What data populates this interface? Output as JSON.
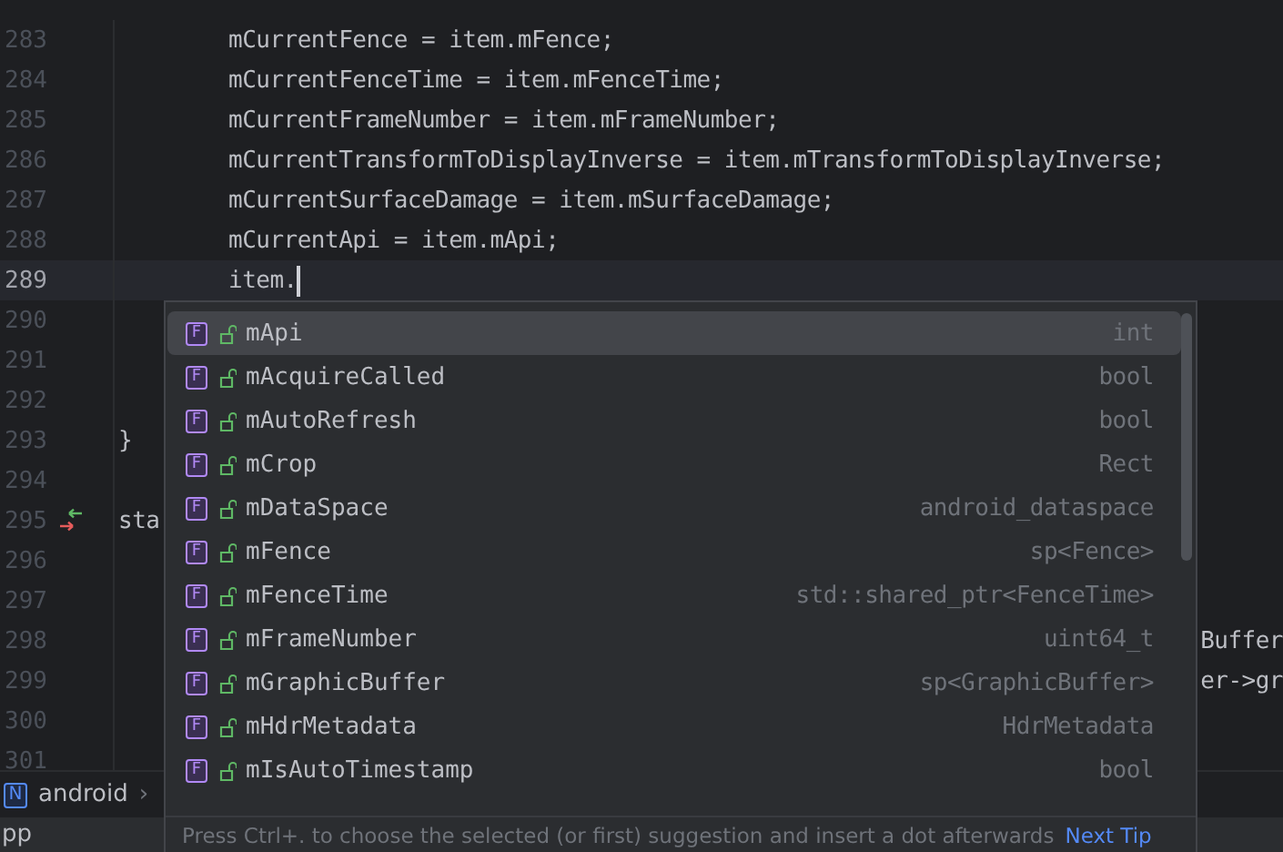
{
  "editor": {
    "lines": [
      {
        "number": "283",
        "text": "        mCurrentFence = item.mFence;",
        "current": false,
        "override": false
      },
      {
        "number": "284",
        "text": "        mCurrentFenceTime = item.mFenceTime;",
        "current": false,
        "override": false
      },
      {
        "number": "285",
        "text": "        mCurrentFrameNumber = item.mFrameNumber;",
        "current": false,
        "override": false
      },
      {
        "number": "286",
        "text": "        mCurrentTransformToDisplayInverse = item.mTransformToDisplayInverse;",
        "current": false,
        "override": false
      },
      {
        "number": "287",
        "text": "        mCurrentSurfaceDamage = item.mSurfaceDamage;",
        "current": false,
        "override": false
      },
      {
        "number": "288",
        "text": "        mCurrentApi = item.mApi;",
        "current": false,
        "override": false
      },
      {
        "number": "289",
        "text": "        item.",
        "current": true,
        "override": false
      },
      {
        "number": "290",
        "current": false,
        "override": false
      },
      {
        "number": "291",
        "current": false,
        "override": false
      },
      {
        "number": "292",
        "current": false,
        "override": false
      },
      {
        "number": "293",
        "text": "}",
        "current": false,
        "override": false
      },
      {
        "number": "294",
        "current": false,
        "override": false
      },
      {
        "number": "295",
        "text": "sta",
        "current": false,
        "override": true
      },
      {
        "number": "296",
        "current": false,
        "override": false
      },
      {
        "number": "297",
        "current": false,
        "override": false
      },
      {
        "number": "298",
        "tail": "Buffer",
        "current": false,
        "override": false
      },
      {
        "number": "299",
        "tail": "er->gr",
        "current": false,
        "override": false
      },
      {
        "number": "300",
        "current": false,
        "override": false
      },
      {
        "number": "301",
        "current": false,
        "override": false
      }
    ]
  },
  "breadcrumb": {
    "badge": "N",
    "label": "android",
    "separator": "›"
  },
  "status_bar": {
    "file": "pp"
  },
  "completion": {
    "items": [
      {
        "badge": "F",
        "name": "mApi",
        "type": "int",
        "selected": true
      },
      {
        "badge": "F",
        "name": "mAcquireCalled",
        "type": "bool",
        "selected": false
      },
      {
        "badge": "F",
        "name": "mAutoRefresh",
        "type": "bool",
        "selected": false
      },
      {
        "badge": "F",
        "name": "mCrop",
        "type": "Rect",
        "selected": false
      },
      {
        "badge": "F",
        "name": "mDataSpace",
        "type": "android_dataspace",
        "selected": false
      },
      {
        "badge": "F",
        "name": "mFence",
        "type": "sp<Fence>",
        "selected": false
      },
      {
        "badge": "F",
        "name": "mFenceTime",
        "type": "std::shared_ptr<FenceTime>",
        "selected": false
      },
      {
        "badge": "F",
        "name": "mFrameNumber",
        "type": "uint64_t",
        "selected": false
      },
      {
        "badge": "F",
        "name": "mGraphicBuffer",
        "type": "sp<GraphicBuffer>",
        "selected": false
      },
      {
        "badge": "F",
        "name": "mHdrMetadata",
        "type": "HdrMetadata",
        "selected": false
      },
      {
        "badge": "F",
        "name": "mIsAutoTimestamp",
        "type": "bool",
        "selected": false
      }
    ],
    "hint": "Press Ctrl+. to choose the selected (or first) suggestion and insert a dot afterwards",
    "next_tip": "Next Tip"
  }
}
